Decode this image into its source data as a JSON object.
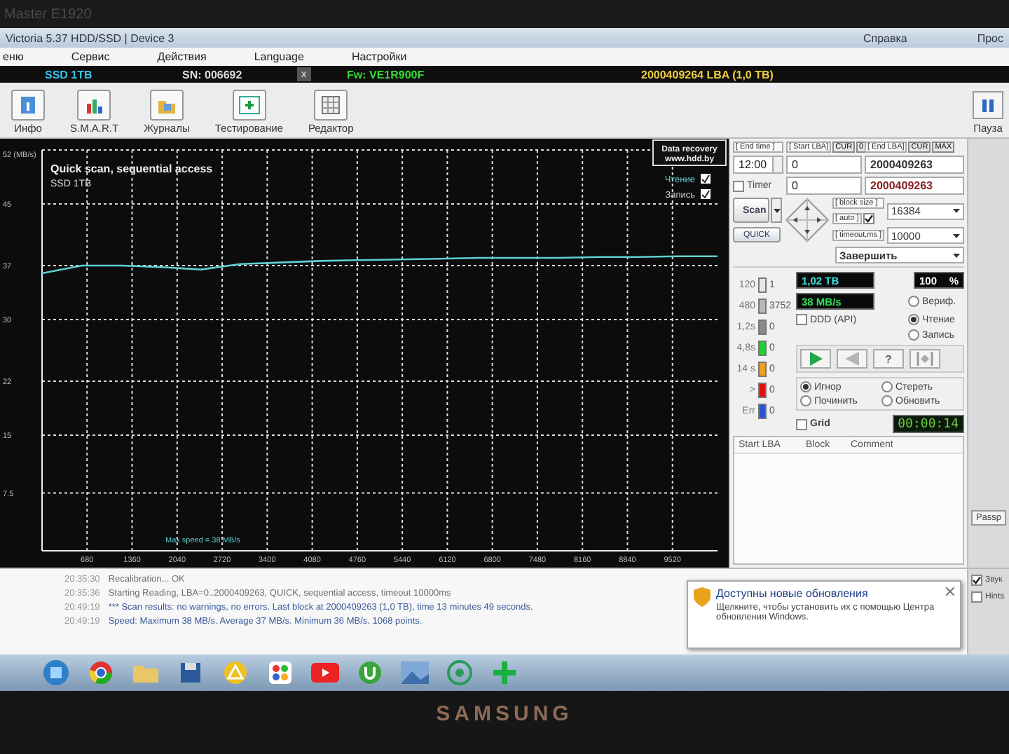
{
  "monitor": {
    "model": "Master E1920",
    "brand": "SAMSUNG"
  },
  "window": {
    "title": "Victoria 5.37 HDD/SSD | Device 3",
    "help": "Справка",
    "edge_text": "Прос"
  },
  "menu": [
    "еню",
    "Сервис",
    "Действия",
    "Language",
    "Настройки"
  ],
  "device_bar": {
    "model": "SSD 1TB",
    "serial": "SN: 006692",
    "close": "x",
    "firmware": "Fw: VE1R900F",
    "capacity": "2000409264 LBA (1,0 TB)"
  },
  "toolbar": [
    {
      "kind": "info",
      "label": "Инфо"
    },
    {
      "kind": "smart",
      "label": "S.M.A.R.T"
    },
    {
      "kind": "logs",
      "label": "Журналы"
    },
    {
      "kind": "test",
      "label": "Тестирование"
    },
    {
      "kind": "editor",
      "label": "Редактор"
    }
  ],
  "pause_button": "Пауза",
  "graph": {
    "title": "Quick scan, sequential access",
    "subtitle": "SSD 1TB",
    "logo": [
      "Data recovery",
      "www.hdd.by"
    ],
    "legend": [
      {
        "checked": true
      },
      {
        "label": "Запись",
        "checked": true
      }
    ],
    "max_speed": "Max speed = 38 MB/s",
    "chart_data": {
      "type": "line",
      "x": [
        0,
        600,
        1200,
        1800,
        2400,
        3000,
        3600,
        4200,
        4800,
        5400,
        6000,
        6600,
        7200,
        7800,
        8400,
        9000,
        9600,
        10200
      ],
      "series": [
        {
          "name": "Чтение",
          "color": "#5fcfcf",
          "values": [
            36,
            37,
            37,
            36.8,
            36.5,
            37.2,
            37.4,
            37.6,
            37.7,
            37.8,
            37.9,
            38,
            38,
            38,
            38.1,
            38.1,
            38.2,
            38.2
          ]
        }
      ],
      "xlim": [
        0,
        10200
      ],
      "ylim": [
        0,
        52
      ],
      "grid": true,
      "xticks": [
        680,
        1360,
        2040,
        2720,
        3400,
        4080,
        4760,
        5440,
        6120,
        6800,
        7480,
        8160,
        8840,
        9520
      ],
      "yticks": [
        7.5,
        15,
        22,
        30,
        37,
        45,
        {
          "value": 52,
          "label": "52 (MB/s)"
        }
      ]
    }
  },
  "scan_panel": {
    "end_time_label": "[ End time ]",
    "start_lba_label": "[ Start LBA]",
    "end_lba_label": "[ End LBA]",
    "start_cur": "CUR",
    "zero": "0",
    "end_cur": "CUR",
    "max": "MAX",
    "end_time": "12:00",
    "start_lba": "0",
    "end_lba": "2000409263",
    "timer": {
      "label": "Timer",
      "checked": false,
      "value": "0"
    },
    "end_lba_current": "2000409263",
    "scan_button": "Scan",
    "quick_button": "QUICK",
    "block_size_label": "[ block size ]",
    "auto_label": "[ auto ]",
    "auto_checked": true,
    "block_size": "16384",
    "timeout_label": "[ timeout,ms ]",
    "timeout": "10000",
    "finish_action": "Завершить"
  },
  "stats": {
    "counters": [
      {
        "label": "120",
        "value": "1",
        "color": "#e8e8e8"
      },
      {
        "label": "480",
        "value": "3752",
        "color": "#b8b8b8"
      },
      {
        "label": "1,2s",
        "value": "0",
        "color": "#8c8c8c"
      },
      {
        "label": "4,8s",
        "value": "0",
        "color": "#22cc33"
      },
      {
        "label": "14 s",
        "value": "0",
        "color": "#f0a020"
      },
      {
        "label": ">",
        "value": "0",
        "color": "#dd1111"
      },
      {
        "label": "Err",
        "value": "0",
        "color": "#2a55d0"
      }
    ],
    "done": "1,02 TB",
    "percent": "100",
    "percent_sign": "%",
    "speed": "38 MB/s",
    "ddd": {
      "label": "DDD (API)",
      "checked": false
    },
    "modes": [
      {
        "label": "Вериф.",
        "selected": false
      },
      {
        "label": "Чтение",
        "selected": true
      },
      {
        "label": "Запись",
        "selected": false
      }
    ],
    "player": [
      {
        "kind": "play"
      },
      {
        "kind": "back"
      },
      {
        "kind": "verify",
        "label": "?"
      },
      {
        "kind": "skip"
      }
    ],
    "actions": [
      {
        "label": "Игнор",
        "selected": true
      },
      {
        "label": "Стереть",
        "selected": false
      },
      {
        "label": "Починить",
        "selected": false
      },
      {
        "label": "Обновить",
        "selected": false
      }
    ],
    "grid": {
      "label": "Grid",
      "checked": false
    },
    "elapsed": "00:00:14"
  },
  "defects_table": {
    "columns": [
      "Start LBA",
      "Block",
      "Comment"
    ]
  },
  "side": {
    "passport_button": "Passp",
    "options": [
      {
        "label": "Звук",
        "checked": true
      },
      {
        "label": "Hints",
        "checked": false
      }
    ]
  },
  "log": [
    {
      "time": "20:35:30",
      "text": "Recalibration... OK",
      "color": "#707070"
    },
    {
      "time": "20:35:36",
      "text": "Starting Reading, LBA=0..2000409263, QUICK, sequential access, timeout 10000ms",
      "color": "#707070"
    },
    {
      "time": "20:49:19",
      "text": "*** Scan results: no warnings, no errors. Last block at 2000409263 (1,0 TB), time 13 minutes 49 seconds.",
      "color": "#3a5a9a"
    },
    {
      "time": "20:49:19",
      "text": "Speed: Maximum 38 MB/s. Average 37 MB/s. Minimum 36 MB/s. 1068 points.",
      "color": "#3a5a9a"
    }
  ],
  "notification": {
    "title": "Доступны новые обновления",
    "body": "Щелкните, чтобы установить их с помощью Центра обновления Windows."
  }
}
